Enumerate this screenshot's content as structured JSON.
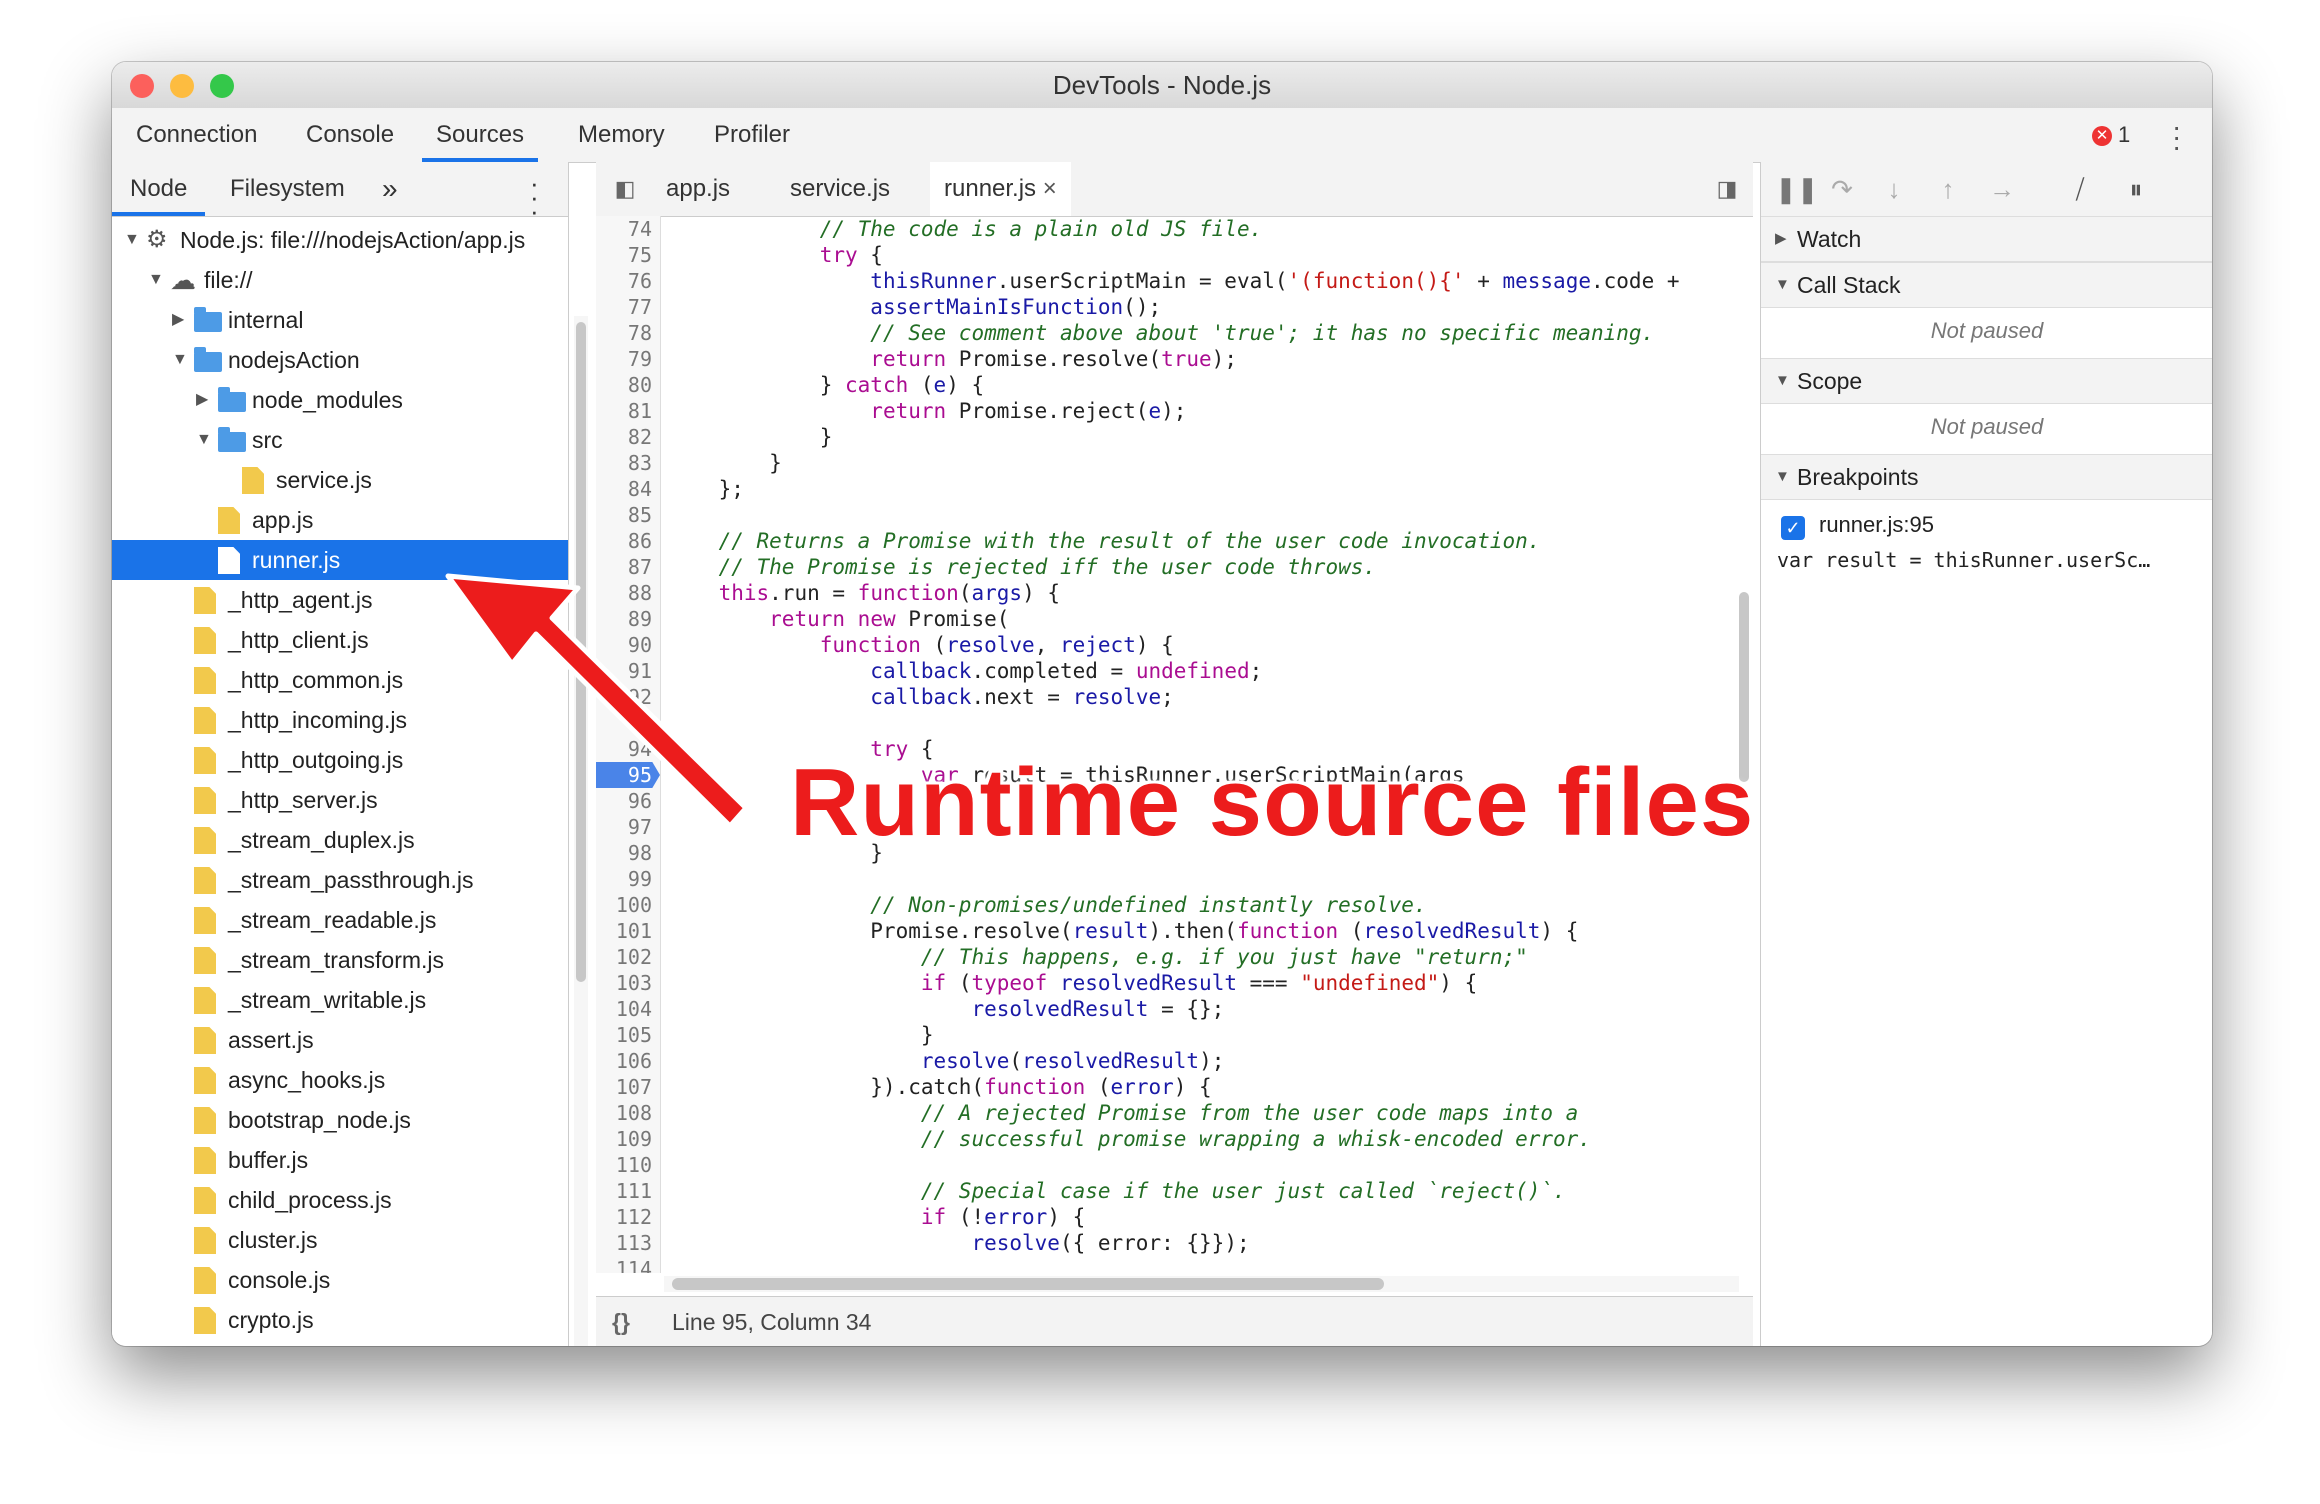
{
  "window": {
    "title": "DevTools - Node.js",
    "traffic_lights": [
      "#fc605c",
      "#fdbc40",
      "#34c84a"
    ]
  },
  "main_tabs": [
    "Connection",
    "Console",
    "Sources",
    "Memory",
    "Profiler"
  ],
  "active_main_tab": "Sources",
  "error_count": "1",
  "navigator": {
    "tabs": [
      "Node",
      "Filesystem"
    ],
    "more": "»",
    "tree": [
      {
        "label": "Node.js: file:///nodejsAction/app.js",
        "type": "root"
      },
      {
        "label": "file://",
        "type": "cloud"
      },
      {
        "label": "internal",
        "type": "folder"
      },
      {
        "label": "nodejsAction",
        "type": "folder"
      },
      {
        "label": "node_modules",
        "type": "folder"
      },
      {
        "label": "src",
        "type": "folder"
      },
      {
        "label": "service.js",
        "type": "file"
      },
      {
        "label": "app.js",
        "type": "file"
      },
      {
        "label": "runner.js",
        "type": "file",
        "selected": true
      },
      {
        "label": "_http_agent.js",
        "type": "file"
      },
      {
        "label": "_http_client.js",
        "type": "file"
      },
      {
        "label": "_http_common.js",
        "type": "file"
      },
      {
        "label": "_http_incoming.js",
        "type": "file"
      },
      {
        "label": "_http_outgoing.js",
        "type": "file"
      },
      {
        "label": "_http_server.js",
        "type": "file"
      },
      {
        "label": "_stream_duplex.js",
        "type": "file"
      },
      {
        "label": "_stream_passthrough.js",
        "type": "file"
      },
      {
        "label": "_stream_readable.js",
        "type": "file"
      },
      {
        "label": "_stream_transform.js",
        "type": "file"
      },
      {
        "label": "_stream_writable.js",
        "type": "file"
      },
      {
        "label": "assert.js",
        "type": "file"
      },
      {
        "label": "async_hooks.js",
        "type": "file"
      },
      {
        "label": "bootstrap_node.js",
        "type": "file"
      },
      {
        "label": "buffer.js",
        "type": "file"
      },
      {
        "label": "child_process.js",
        "type": "file"
      },
      {
        "label": "cluster.js",
        "type": "file"
      },
      {
        "label": "console.js",
        "type": "file"
      },
      {
        "label": "crypto.js",
        "type": "file"
      }
    ]
  },
  "editor": {
    "tabs": [
      "app.js",
      "service.js",
      "runner.js"
    ],
    "active_tab": "runner.js",
    "close_glyph": "×",
    "breakpoint_line": "95",
    "status": "Line 95, Column 34",
    "format_button": "{}",
    "lines": [
      {
        "n": "74",
        "html": "            <span class='cm'>// The code is a plain old JS file.</span>"
      },
      {
        "n": "75",
        "html": "            <span class='kw'>try</span> {"
      },
      {
        "n": "76",
        "html": "                <span class='vs'>thisRunner</span>.userScriptMain = eval(<span class='st'>'(function(){'</span> + <span class='vs'>message</span>.code +"
      },
      {
        "n": "77",
        "html": "                <span class='vs'>assertMainIsFunction</span>();"
      },
      {
        "n": "78",
        "html": "                <span class='cm'>// See comment above about 'true'; it has no specific meaning.</span>"
      },
      {
        "n": "79",
        "html": "                <span class='kw'>return</span> Promise.resolve(<span class='kw'>true</span>);"
      },
      {
        "n": "80",
        "html": "            } <span class='kw'>catch</span> (<span class='vs'>e</span>) {"
      },
      {
        "n": "81",
        "html": "                <span class='kw'>return</span> Promise.reject(<span class='vs'>e</span>);"
      },
      {
        "n": "82",
        "html": "            }"
      },
      {
        "n": "83",
        "html": "        }"
      },
      {
        "n": "84",
        "html": "    };"
      },
      {
        "n": "85",
        "html": ""
      },
      {
        "n": "86",
        "html": "    <span class='cm'>// Returns a Promise with the result of the user code invocation.</span>"
      },
      {
        "n": "87",
        "html": "    <span class='cm'>// The Promise is rejected iff the user code throws.</span>"
      },
      {
        "n": "88",
        "html": "    <span class='kw'>this</span>.run = <span class='kw'>function</span>(<span class='vs'>args</span>) {"
      },
      {
        "n": "89",
        "html": "        <span class='kw'>return</span> <span class='kw'>new</span> Promise("
      },
      {
        "n": "90",
        "html": "            <span class='kw'>function</span> (<span class='vs'>resolve</span>, <span class='vs'>reject</span>) {"
      },
      {
        "n": "91",
        "html": "                <span class='vs'>callback</span>.completed = <span class='kw'>undefined</span>;"
      },
      {
        "n": "92",
        "html": "                <span class='vs'>callback</span>.next = <span class='vs'>resolve</span>;"
      },
      {
        "n": "93",
        "html": ""
      },
      {
        "n": "94",
        "html": "                <span class='kw'>try</span> {"
      },
      {
        "n": "95",
        "html": "                    <span class='kw'>var</span> result = thisRunner.userScriptMain(args"
      },
      {
        "n": "96",
        "html": ""
      },
      {
        "n": "97",
        "html": ""
      },
      {
        "n": "98",
        "html": "                }"
      },
      {
        "n": "99",
        "html": ""
      },
      {
        "n": "100",
        "html": "                <span class='cm'>// Non-promises/undefined instantly resolve.</span>"
      },
      {
        "n": "101",
        "html": "                Promise.resolve(<span class='vs'>result</span>).then(<span class='kw'>function</span> (<span class='vs'>resolvedResult</span>) {"
      },
      {
        "n": "102",
        "html": "                    <span class='cm'>// This happens, e.g. if you just have \"return;\"</span>"
      },
      {
        "n": "103",
        "html": "                    <span class='kw'>if</span> (<span class='kw'>typeof</span> <span class='vs'>resolvedResult</span> === <span class='st'>\"undefined\"</span>) {"
      },
      {
        "n": "104",
        "html": "                        <span class='vs'>resolvedResult</span> = {};"
      },
      {
        "n": "105",
        "html": "                    }"
      },
      {
        "n": "106",
        "html": "                    <span class='vs'>resolve</span>(<span class='vs'>resolvedResult</span>);"
      },
      {
        "n": "107",
        "html": "                }).catch(<span class='kw'>function</span> (<span class='vs'>error</span>) {"
      },
      {
        "n": "108",
        "html": "                    <span class='cm'>// A rejected Promise from the user code maps into a</span>"
      },
      {
        "n": "109",
        "html": "                    <span class='cm'>// successful promise wrapping a whisk-encoded error.</span>"
      },
      {
        "n": "110",
        "html": ""
      },
      {
        "n": "111",
        "html": "                    <span class='cm'>// Special case if the user just called `reject()`.</span>"
      },
      {
        "n": "112",
        "html": "                    <span class='kw'>if</span> (!<span class='vs'>error</span>) {"
      },
      {
        "n": "113",
        "html": "                        <span class='vs'>resolve</span>({ error: {}});"
      },
      {
        "n": "114",
        "html": ""
      }
    ]
  },
  "debugger": {
    "sections": [
      "Watch",
      "Call Stack",
      "Scope",
      "Breakpoints"
    ],
    "not_paused": "Not paused",
    "breakpoint": {
      "label": "runner.js:95",
      "code": "var result = thisRunner.userSc…",
      "checked": true
    }
  },
  "annotation": {
    "text": "Runtime source files",
    "color": "#ec1c1c"
  }
}
